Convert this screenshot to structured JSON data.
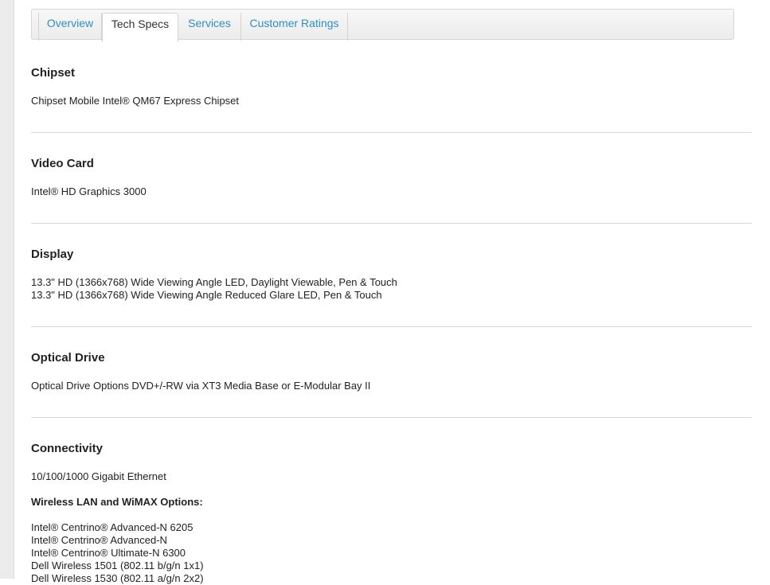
{
  "tabs": [
    {
      "label": "Overview",
      "active": false
    },
    {
      "label": "Tech Specs",
      "active": true
    },
    {
      "label": "Services",
      "active": false
    },
    {
      "label": "Customer Ratings",
      "active": false
    }
  ],
  "sections": {
    "chipset": {
      "title": "Chipset",
      "lines": [
        "Chipset Mobile Intel® QM67 Express Chipset"
      ]
    },
    "video_card": {
      "title": "Video Card",
      "lines": [
        "Intel® HD Graphics 3000"
      ]
    },
    "display": {
      "title": "Display",
      "lines": [
        "13.3\" HD (1366x768) Wide Viewing Angle LED, Daylight Viewable, Pen & Touch",
        "13.3\" HD (1366x768) Wide Viewing Angle Reduced Glare LED, Pen & Touch"
      ]
    },
    "optical_drive": {
      "title": "Optical Drive",
      "lines": [
        "Optical Drive Options DVD+/-RW via XT3 Media Base or E-Modular Bay II"
      ]
    },
    "connectivity": {
      "title": "Connectivity",
      "lines": [
        "10/100/1000 Gigabit Ethernet"
      ],
      "wireless_heading": "Wireless LAN and WiMAX Options:",
      "wireless_lines": [
        "Intel® Centrino® Advanced-N 6205",
        "Intel® Centrino® Advanced-N",
        "Intel® Centrino® Ultimate-N 6300",
        "Dell Wireless 1501 (802.11 b/g/n 1x1)",
        "Dell Wireless 1530 (802.11 a/g/n 2x2)"
      ]
    }
  },
  "colors": {
    "tab_link": "#2f8ec4",
    "tab_active_text": "#333333",
    "divider": "#d8d8d8",
    "rail": "#ececec"
  }
}
